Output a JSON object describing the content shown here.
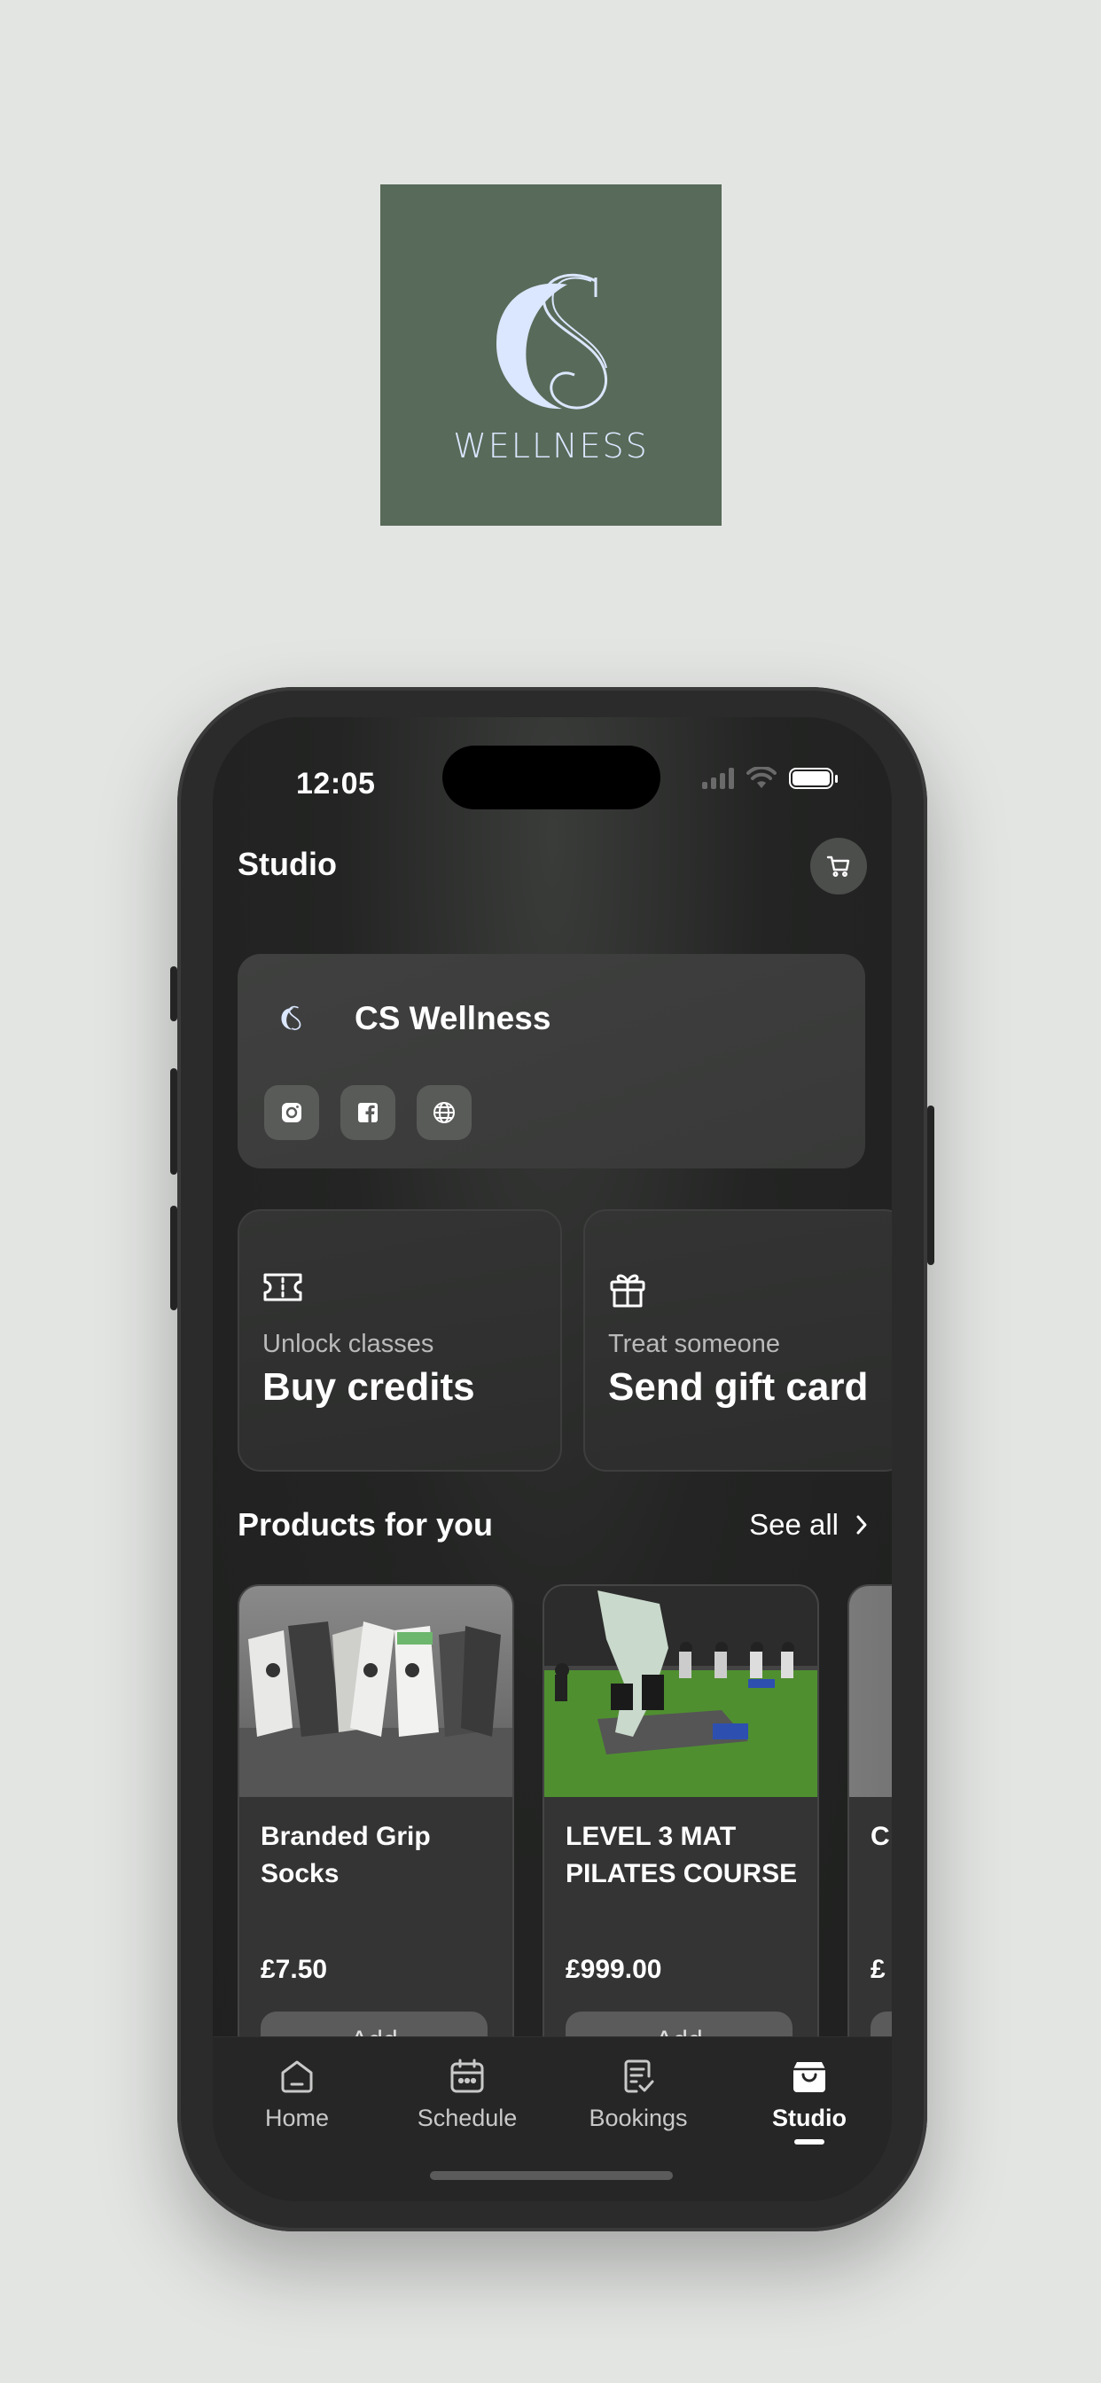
{
  "brand": {
    "logo_text": "WELLNESS",
    "colors": {
      "logo_bg": "#586a59",
      "logo_fg": "#dbe6ff",
      "phone_bg": "#232423"
    }
  },
  "status_bar": {
    "time": "12:05"
  },
  "header": {
    "title": "Studio",
    "cart_icon": "cart-icon"
  },
  "studio": {
    "name": "CS Wellness",
    "socials": [
      {
        "icon": "instagram-icon"
      },
      {
        "icon": "facebook-icon"
      },
      {
        "icon": "globe-icon"
      }
    ]
  },
  "actions": [
    {
      "icon": "ticket-icon",
      "subtitle": "Unlock classes",
      "title": "Buy credits"
    },
    {
      "icon": "gift-icon",
      "subtitle": "Treat someone",
      "title": "Send gift card"
    }
  ],
  "products_section": {
    "title": "Products for you",
    "see_all": "See all"
  },
  "products": [
    {
      "name": "Branded Grip Socks",
      "price": "£7.50",
      "button": "Add"
    },
    {
      "name": "LEVEL 3 MAT PILATES COURSE",
      "price": "£999.00",
      "button": "Add"
    },
    {
      "name": "C",
      "price": "£",
      "button": ""
    }
  ],
  "tabs": [
    {
      "label": "Home",
      "icon": "home-icon",
      "active": false
    },
    {
      "label": "Schedule",
      "icon": "calendar-icon",
      "active": false
    },
    {
      "label": "Bookings",
      "icon": "bookings-icon",
      "active": false
    },
    {
      "label": "Studio",
      "icon": "bag-icon",
      "active": true
    }
  ]
}
